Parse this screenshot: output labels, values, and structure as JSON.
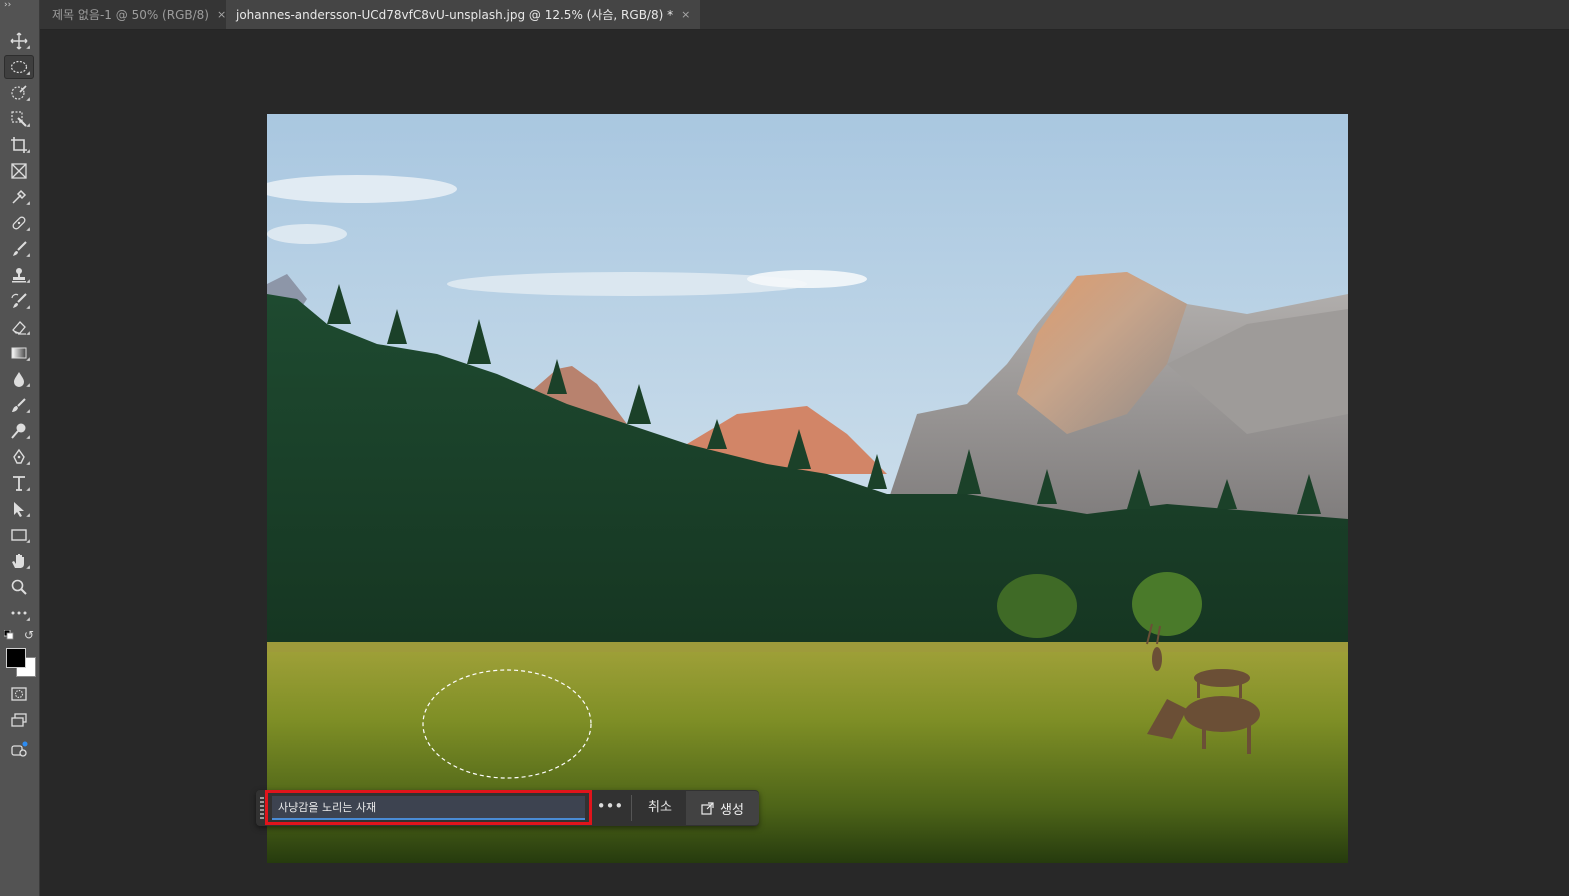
{
  "tabs": [
    {
      "label": "제목 없음-1 @ 50% (RGB/8)",
      "active": false
    },
    {
      "label": "johannes-andersson-UCd78vfC8vU-unsplash.jpg @ 12.5% (사슴, RGB/8) *",
      "active": true
    }
  ],
  "tab_close_glyph": "×",
  "toolbar": {
    "tools": [
      "move-tool-icon",
      "elliptical-marquee-tool-icon",
      "object-selection-tool-icon",
      "remove-tool-icon",
      "crop-tool-icon",
      "frame-tool-icon",
      "eyedropper-tool-icon",
      "spot-healing-tool-icon",
      "brush-tool-icon",
      "clone-stamp-tool-icon",
      "history-brush-tool-icon",
      "eraser-tool-icon",
      "gradient-tool-icon",
      "blur-tool-icon",
      "smudge-tool-icon",
      "dodge-tool-icon",
      "pen-tool-icon",
      "type-tool-icon",
      "path-selection-tool-icon",
      "rectangle-tool-icon",
      "hand-tool-icon",
      "zoom-tool-icon",
      "edit-toolbar-icon"
    ],
    "active_tool": "elliptical-marquee-tool-icon",
    "foreground_color": "#000000",
    "background_color": "#ffffff"
  },
  "taskbar": {
    "prompt_value": "사냥감을 노리는 사재",
    "more_glyph": "•••",
    "cancel_label": "취소",
    "generate_label": "생성"
  },
  "colors": {
    "app_bg": "#282828",
    "toolbar_bg": "#535353",
    "highlight_box": "#e0141b",
    "input_focus": "#4a8cd6"
  }
}
